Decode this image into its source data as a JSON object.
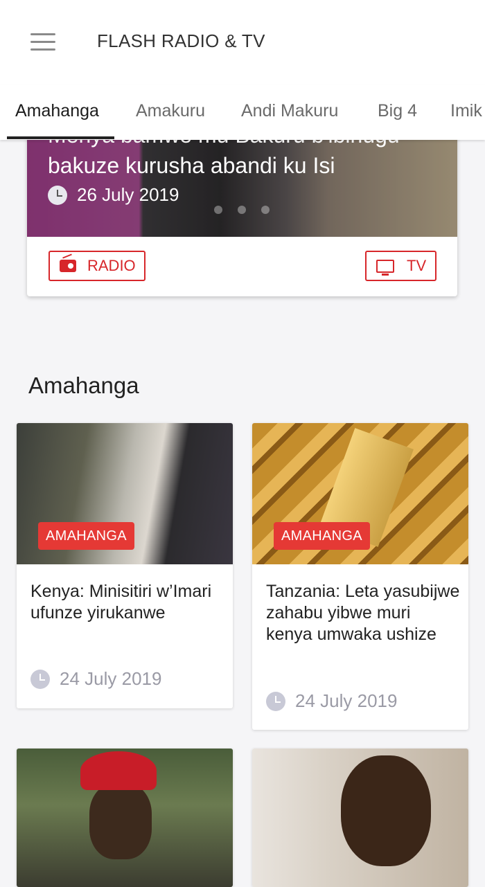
{
  "app": {
    "title": "FLASH RADIO & TV"
  },
  "tabs": [
    {
      "label": "Amahanga",
      "active": true
    },
    {
      "label": "Amakuru"
    },
    {
      "label": "Andi Makuru"
    },
    {
      "label": "Big 4"
    },
    {
      "label": "Imik"
    }
  ],
  "featured": {
    "title_line1": "Menya bamwe mu Bakuru b'ibihugu",
    "title_line2": "bakuze kurusha abandi ku Isi",
    "date": "26 July 2019",
    "radio_label": "RADIO",
    "tv_label": "TV"
  },
  "section": {
    "title": "Amahanga",
    "cards": [
      {
        "badge": "AMAHANGA",
        "title": "Kenya: Minisitiri w’Imari ufunze yirukanwe",
        "date": "24 July 2019"
      },
      {
        "badge": "AMAHANGA",
        "title": "Tanzania: Leta yasubijwe zahabu yibwe muri kenya umwaka ushize",
        "date": "24 July 2019"
      }
    ]
  },
  "colors": {
    "accent": "#d7262a",
    "badge": "#e53935",
    "background": "#f5f5f7"
  }
}
